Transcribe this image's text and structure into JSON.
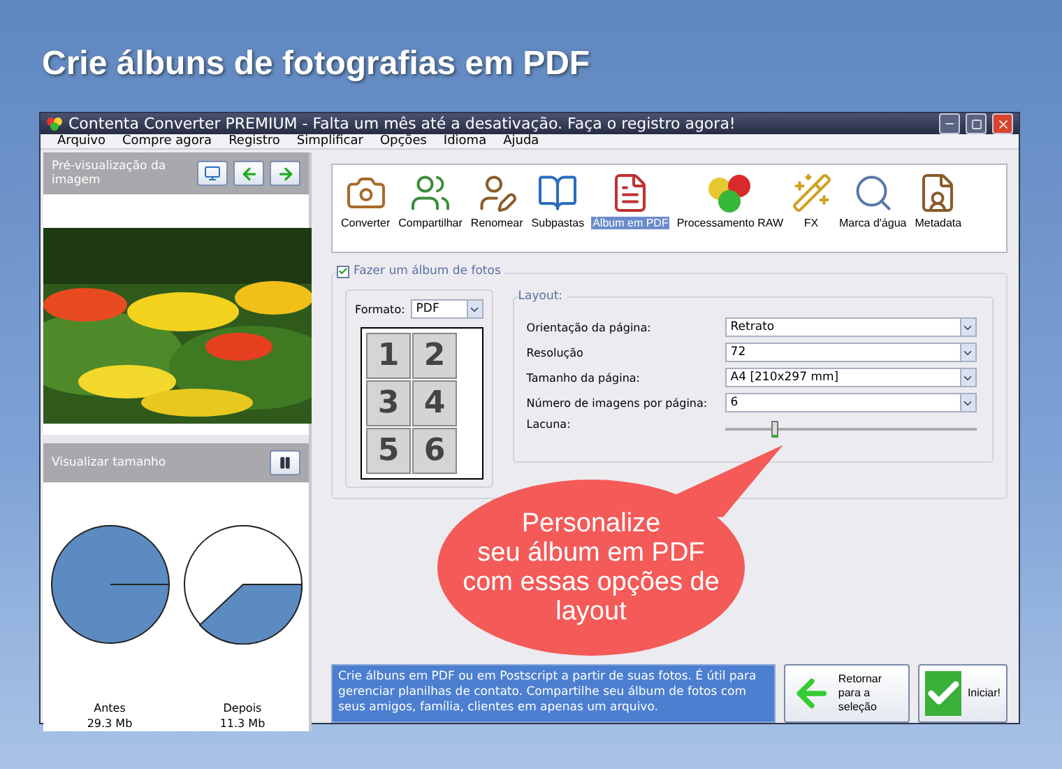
{
  "headline": "Crie álbuns de fotografias em PDF",
  "window": {
    "title": "Contenta Converter PREMIUM  - Falta um mês até a desativação. Faça o registro agora!"
  },
  "menu": [
    "Arquivo",
    "Compre agora",
    "Registro",
    "Simplificar",
    "Opções",
    "Idioma",
    "Ajuda"
  ],
  "preview": {
    "title": "Pré-visualização da imagem"
  },
  "size_view": {
    "title": "Visualizar tamanho",
    "before_label": "Antes",
    "before_size": "29.3 Mb",
    "after_label": "Depois",
    "after_size": "11.3 Mb"
  },
  "toolbar": [
    {
      "label": "Converter",
      "selected": false
    },
    {
      "label": "Compartilhar",
      "selected": false
    },
    {
      "label": "Renomear",
      "selected": false
    },
    {
      "label": "Subpastas",
      "selected": false
    },
    {
      "label": "Álbum em PDF",
      "selected": true
    },
    {
      "label": "Processamento RAW",
      "selected": false
    },
    {
      "label": "FX",
      "selected": false
    },
    {
      "label": "Marca d'água",
      "selected": false
    },
    {
      "label": "Metadata",
      "selected": false
    }
  ],
  "album": {
    "label": "Fazer um álbum de fotos",
    "checked": true,
    "format_label": "Formato:",
    "format_value": "PDF",
    "grid": [
      "1",
      "2",
      "3",
      "4",
      "5",
      "6"
    ],
    "layout_title": "Layout:",
    "fields": [
      {
        "label": "Orientação da página:",
        "value": "Retrato"
      },
      {
        "label": "Resolução",
        "value": "72"
      },
      {
        "label": "Tamanho da página:",
        "value": "A4 [210x297 mm]"
      },
      {
        "label": "Número de imagens por página:",
        "value": "6"
      }
    ],
    "gap": {
      "label": "Lacuna:",
      "level": 0.18
    }
  },
  "callout": [
    "Personalize",
    "seu álbum em PDF",
    "com essas opções de",
    "layout"
  ],
  "description": "Crie álbuns em PDF ou em Postscript a partir de suas fotos. É útil para gerenciar planilhas de contato. Compartilhe seu álbum de fotos com seus amigos, família, clientes em apenas um arquivo.",
  "buttons": {
    "back": [
      "Retornar",
      "para a seleção"
    ],
    "start": "Iniciar!"
  }
}
